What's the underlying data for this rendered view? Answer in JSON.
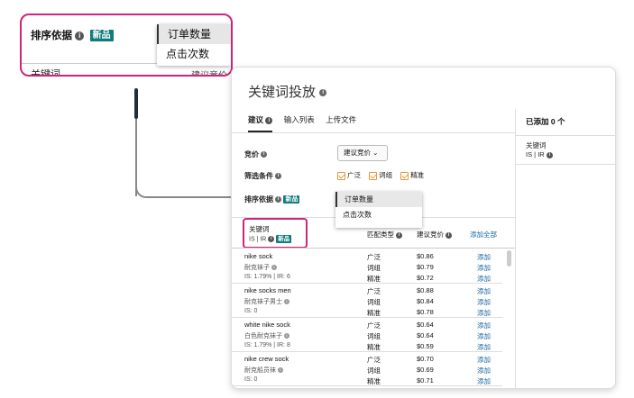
{
  "callout": {
    "sort_label": "排序依据",
    "new_badge": "新品",
    "keyword_label": "关键词",
    "cut_text": "建议竞价",
    "dropdown": [
      "订单数量",
      "点击次数"
    ]
  },
  "card": {
    "title": "关键词投放",
    "tabs": [
      "建议",
      "输入列表",
      "上传文件"
    ],
    "added_label": "已添加 0 个",
    "right_keyword": "关键词",
    "right_keyword_sub": "IS | IR",
    "bid_label": "竞价",
    "bid_select": "建议竞价",
    "filter_label": "筛选条件",
    "filters": [
      "广泛",
      "词组",
      "精准"
    ],
    "sort_label": "排序依据",
    "new_badge": "新品",
    "sort_options": [
      "订单数量",
      "点击次数"
    ],
    "table": {
      "col_keyword": "关键词",
      "col_keyword_sub": "IS | IR",
      "col_match": "匹配类型",
      "col_bid": "建议竞价",
      "add_all": "添加全部",
      "add": "添加",
      "groups": [
        {
          "kw": "nike sock",
          "cn": "耐克袜子",
          "is": "IS: 1.79% | IR: 6",
          "rows": [
            [
              "广泛",
              "$0.86"
            ],
            [
              "词组",
              "$0.79"
            ],
            [
              "精准",
              "$0.72"
            ]
          ]
        },
        {
          "kw": "nike socks men",
          "cn": "耐克袜子男士",
          "is": "IS: 0",
          "rows": [
            [
              "广泛",
              "$0.88"
            ],
            [
              "词组",
              "$0.84"
            ],
            [
              "精准",
              "$0.78"
            ]
          ]
        },
        {
          "kw": "white nike sock",
          "cn": "白色耐克袜子",
          "is": "IS: 1.79% | IR: 8",
          "rows": [
            [
              "广泛",
              "$0.64"
            ],
            [
              "词组",
              "$0.64"
            ],
            [
              "精准",
              "$0.59"
            ]
          ]
        },
        {
          "kw": "nike crew sock",
          "cn": "耐克船员袜",
          "is": "IS: 0",
          "rows": [
            [
              "广泛",
              "$0.70"
            ],
            [
              "词组",
              "$0.69"
            ],
            [
              "精准",
              "$0.71"
            ]
          ]
        }
      ]
    }
  },
  "colors": {
    "accent_pink": "#d1237a",
    "badge_teal": "#0f7b7b",
    "link_blue": "#1764a3",
    "checkbox_orange": "#e39a3b"
  }
}
